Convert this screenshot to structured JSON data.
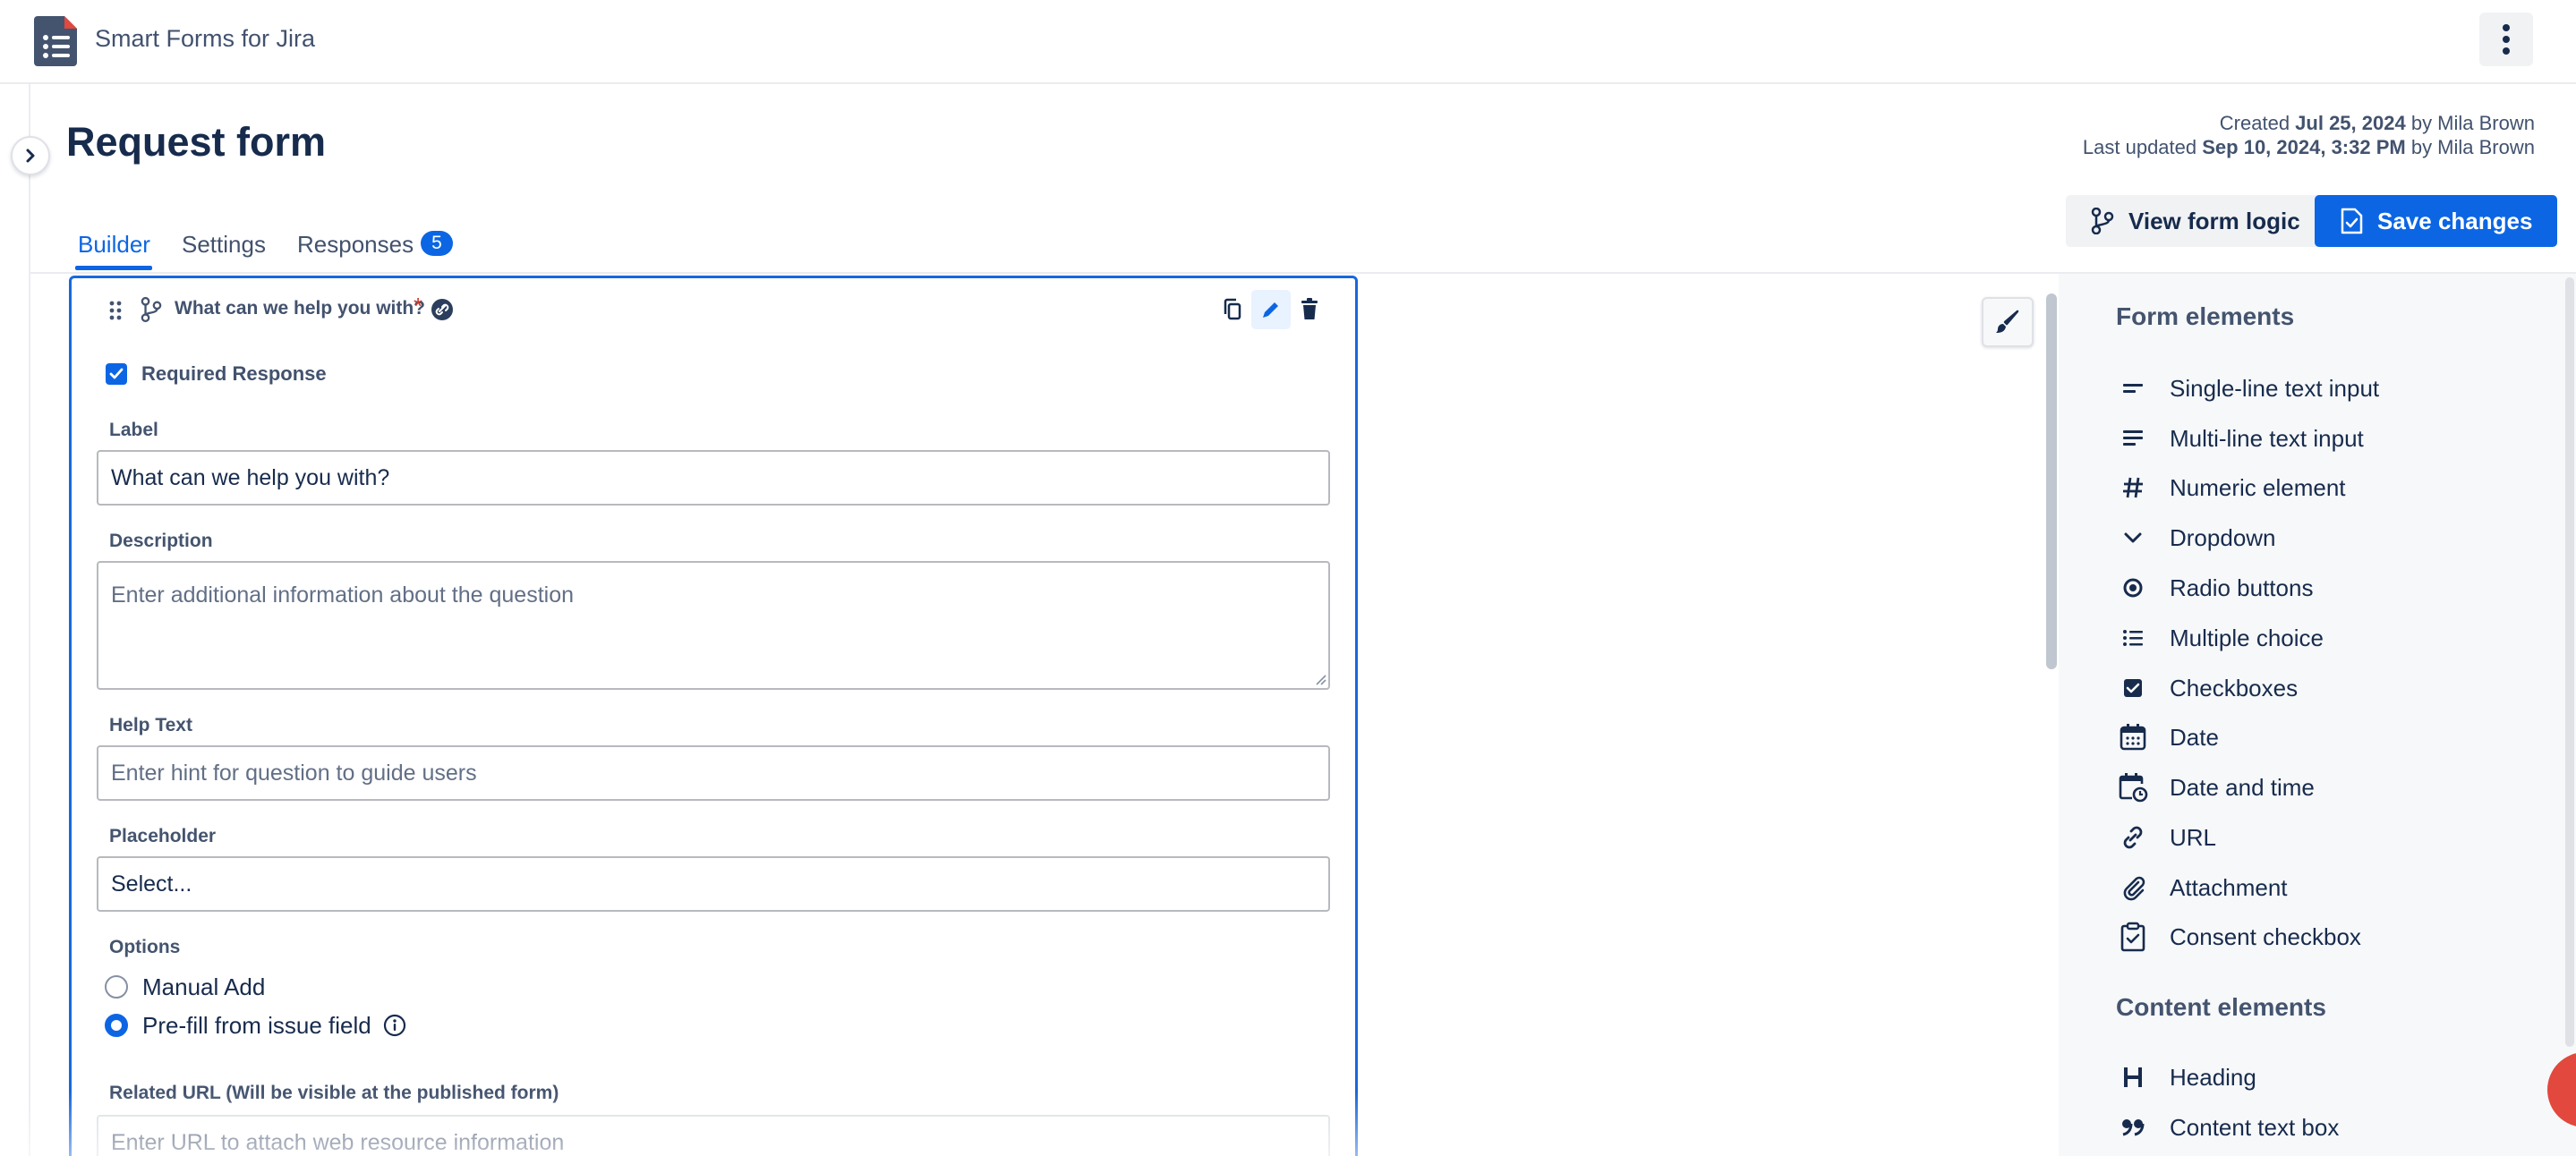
{
  "app": {
    "title": "Smart Forms for Jira"
  },
  "page": {
    "title": "Request form",
    "created_prefix": "Created ",
    "created_date": "Jul 25, 2024",
    "created_by": " by Mila Brown",
    "updated_prefix": "Last updated ",
    "updated_date": "Sep 10, 2024, 3:32 PM",
    "updated_by": " by Mila Brown"
  },
  "tabs": [
    {
      "label": "Builder"
    },
    {
      "label": "Settings"
    },
    {
      "label": "Responses",
      "badge": "5"
    }
  ],
  "toolbar": {
    "view_logic_label": "View form logic",
    "save_label": "Save changes"
  },
  "field": {
    "title": "What can we help you with?",
    "required_star": "*",
    "required_label": "Required Response",
    "label_label": "Label",
    "label_value": "What can we help you with?",
    "description_label": "Description",
    "description_placeholder": "Enter additional information about the question",
    "help_label": "Help Text",
    "help_placeholder": "Enter hint for question to guide users",
    "placeholder_label": "Placeholder",
    "placeholder_value": "Select...",
    "options_label": "Options",
    "option_manual": "Manual Add",
    "option_prefill": "Pre-fill from issue field",
    "related_url_label": "Related URL (Will be visible at the published form)",
    "related_url_placeholder": "Enter URL to attach web resource information"
  },
  "panel": {
    "form_elements_title": "Form elements",
    "form_elements": [
      {
        "label": "Single-line text input",
        "icon": "short-text-icon"
      },
      {
        "label": "Multi-line text input",
        "icon": "long-text-icon"
      },
      {
        "label": "Numeric element",
        "icon": "hash-icon"
      },
      {
        "label": "Dropdown",
        "icon": "chevron-down-icon"
      },
      {
        "label": "Radio buttons",
        "icon": "radio-icon"
      },
      {
        "label": "Multiple choice",
        "icon": "list-icon"
      },
      {
        "label": "Checkboxes",
        "icon": "checkbox-icon"
      },
      {
        "label": "Date",
        "icon": "calendar-icon"
      },
      {
        "label": "Date and time",
        "icon": "calendar-clock-icon"
      },
      {
        "label": "URL",
        "icon": "link-icon"
      },
      {
        "label": "Attachment",
        "icon": "paperclip-icon"
      },
      {
        "label": "Consent checkbox",
        "icon": "clipboard-check-icon"
      }
    ],
    "content_elements_title": "Content elements",
    "content_elements": [
      {
        "label": "Heading",
        "icon": "heading-icon"
      },
      {
        "label": "Content text box",
        "icon": "quote-icon"
      }
    ]
  },
  "colors": {
    "accent": "#0c66e4",
    "required": "#c9372c",
    "fab": "#e2483d"
  }
}
